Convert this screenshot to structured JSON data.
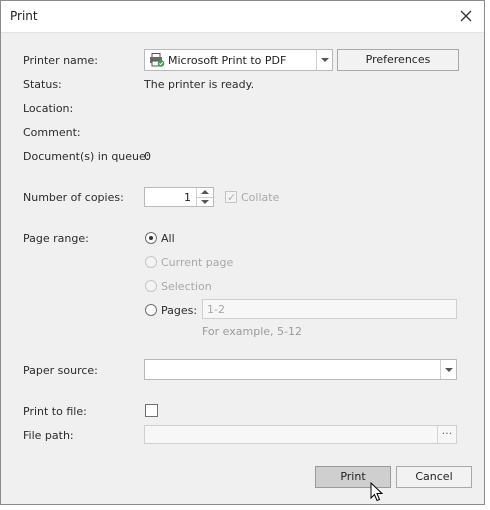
{
  "dialog": {
    "title": "Print"
  },
  "printer": {
    "name_label": "Printer name:",
    "name_value": "Microsoft Print to PDF",
    "preferences_button": "Preferences",
    "status_label": "Status:",
    "status_value": "The printer is ready.",
    "location_label": "Location:",
    "comment_label": "Comment:",
    "queue_label": "Document(s) in queue:",
    "queue_value": "0"
  },
  "copies": {
    "label": "Number of copies:",
    "value": "1",
    "collate_label": "Collate",
    "collate_checked": true,
    "collate_enabled": false
  },
  "page_range": {
    "label": "Page range:",
    "options": [
      {
        "label": "All",
        "selected": true,
        "enabled": true
      },
      {
        "label": "Current page",
        "selected": false,
        "enabled": false
      },
      {
        "label": "Selection",
        "selected": false,
        "enabled": false
      },
      {
        "label": "Pages:",
        "selected": false,
        "enabled": true
      }
    ],
    "pages_value": "1-2",
    "pages_hint": "For example, 5-12"
  },
  "paper_source": {
    "label": "Paper source:",
    "value": ""
  },
  "print_to_file": {
    "label": "Print to file:",
    "checked": false,
    "file_path_label": "File path:",
    "file_path_value": "",
    "browse_label": "···"
  },
  "buttons": {
    "print": "Print",
    "cancel": "Cancel"
  },
  "icons": [
    "close-icon",
    "printer-icon",
    "dropdown-arrow-icon",
    "spin-up-icon",
    "spin-down-icon",
    "checkmark-icon",
    "mouse-cursor-icon"
  ]
}
